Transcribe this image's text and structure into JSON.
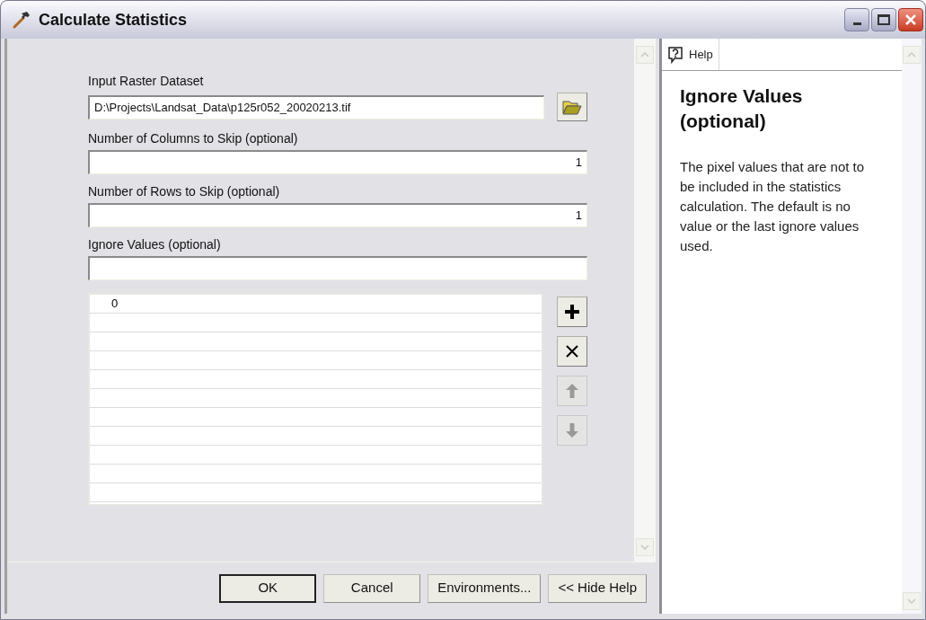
{
  "window": {
    "title": "Calculate Statistics"
  },
  "form": {
    "fields": [
      {
        "kind": "file",
        "label": "Input Raster Dataset",
        "value": "D:\\Projects\\Landsat_Data\\p125r052_20020213.tif"
      },
      {
        "kind": "number",
        "label": "Number of Columns to Skip (optional)",
        "value": "1"
      },
      {
        "kind": "number",
        "label": "Number of Rows to Skip (optional)",
        "value": "1"
      },
      {
        "kind": "text",
        "label": "Ignore Values (optional)"
      }
    ],
    "values_list": {
      "items": [
        "0"
      ]
    },
    "list_buttons": [
      {
        "kind": "add",
        "disabled": false
      },
      {
        "kind": "delete",
        "disabled": false
      },
      {
        "kind": "up",
        "disabled": true
      },
      {
        "kind": "down",
        "disabled": true
      }
    ]
  },
  "buttons": [
    {
      "label": "OK",
      "default": true
    },
    {
      "label": "Cancel",
      "default": false
    },
    {
      "label": "Environments...",
      "default": false
    },
    {
      "label": "<< Hide Help",
      "default": false
    }
  ],
  "help": {
    "tab": "Help",
    "title": "Ignore Values (optional)",
    "text": "The pixel values that are not to be included in the statistics calculation. The default is no value or the last ignore values used."
  }
}
